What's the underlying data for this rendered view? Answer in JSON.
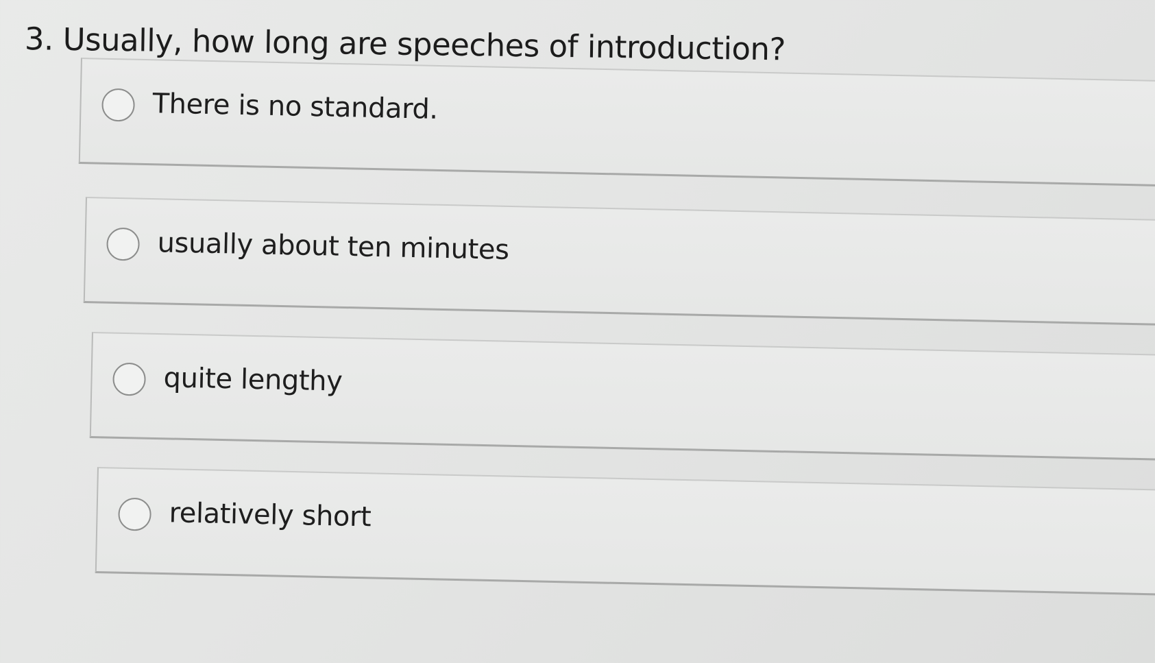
{
  "question": {
    "text": "3. Usually, how long are speeches of introduction?"
  },
  "options": [
    {
      "label": "There is no standard.",
      "selected": false
    },
    {
      "label": "usually about ten minutes",
      "selected": false
    },
    {
      "label": "quite lengthy",
      "selected": false
    },
    {
      "label": "relatively short",
      "selected": false
    }
  ]
}
